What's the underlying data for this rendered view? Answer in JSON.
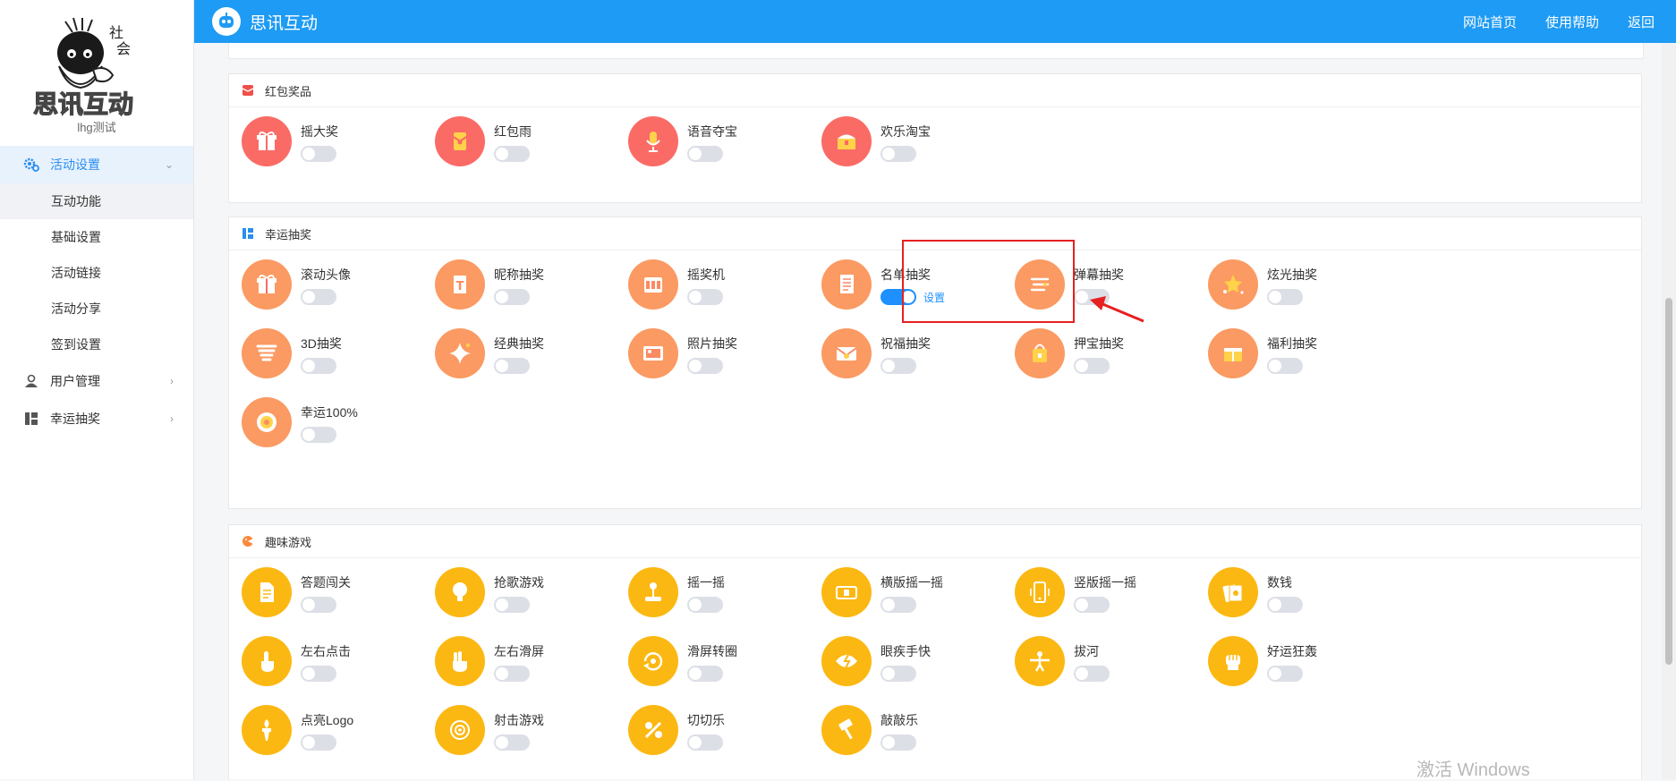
{
  "app": {
    "logo_text": "思讯互动",
    "account_name": "lhg测试",
    "header_title": "思讯互动",
    "nav": [
      "网站首页",
      "使用帮助",
      "返回"
    ]
  },
  "sidebar": {
    "groups": [
      {
        "label": "活动设置",
        "icon": "gear-icon",
        "expanded": true,
        "subitems": [
          "互动功能",
          "基础设置",
          "活动链接",
          "活动分享",
          "签到设置"
        ]
      },
      {
        "label": "用户管理",
        "icon": "user-icon",
        "expanded": false
      },
      {
        "label": "幸运抽奖",
        "icon": "grid-icon",
        "expanded": false
      }
    ]
  },
  "sections": [
    {
      "title": "红包奖品",
      "icon": "red-packet-icon",
      "items": [
        {
          "label": "摇大奖",
          "on": false,
          "color": "red",
          "icon": "gift-box-icon"
        },
        {
          "label": "红包雨",
          "on": false,
          "color": "red",
          "icon": "red-envelope-icon"
        },
        {
          "label": "语音夺宝",
          "on": false,
          "color": "red",
          "icon": "microphone-icon"
        },
        {
          "label": "欢乐淘宝",
          "on": false,
          "color": "red",
          "icon": "treasure-chest-icon"
        }
      ]
    },
    {
      "title": "幸运抽奖",
      "icon": "lottery-icon",
      "items": [
        {
          "label": "滚动头像",
          "on": false,
          "color": "orange",
          "icon": "gift-box-icon"
        },
        {
          "label": "昵称抽奖",
          "on": false,
          "color": "orange",
          "icon": "letter-card-icon"
        },
        {
          "label": "摇奖机",
          "on": false,
          "color": "orange",
          "icon": "slot-machine-icon"
        },
        {
          "label": "名单抽奖",
          "on": true,
          "color": "orange",
          "icon": "list-icon",
          "link": "设置"
        },
        {
          "label": "弹幕抽奖",
          "on": false,
          "color": "orange",
          "icon": "danmaku-icon"
        },
        {
          "label": "炫光抽奖",
          "on": false,
          "color": "orange",
          "icon": "stars-icon"
        },
        {
          "label": "3D抽奖",
          "on": false,
          "color": "orange",
          "icon": "tornado-icon"
        },
        {
          "label": "经典抽奖",
          "on": false,
          "color": "orange",
          "icon": "sparkle-icon"
        },
        {
          "label": "照片抽奖",
          "on": false,
          "color": "orange",
          "icon": "photo-icon"
        },
        {
          "label": "祝福抽奖",
          "on": false,
          "color": "orange",
          "icon": "envelope-icon"
        },
        {
          "label": "押宝抽奖",
          "on": false,
          "color": "orange",
          "icon": "bag-icon"
        },
        {
          "label": "福利抽奖",
          "on": false,
          "color": "orange",
          "icon": "gift-card-icon"
        },
        {
          "label": "幸运100%",
          "on": false,
          "color": "orange",
          "icon": "target-icon"
        }
      ]
    },
    {
      "title": "趣味游戏",
      "icon": "game-icon",
      "items": [
        {
          "label": "答题闯关",
          "on": false,
          "color": "yellow",
          "icon": "document-icon"
        },
        {
          "label": "抢歌游戏",
          "on": false,
          "color": "yellow",
          "icon": "bulb-icon"
        },
        {
          "label": "摇一摇",
          "on": false,
          "color": "yellow",
          "icon": "joystick-icon"
        },
        {
          "label": "横版摇一摇",
          "on": false,
          "color": "yellow",
          "icon": "phone-landscape-icon"
        },
        {
          "label": "竖版摇一摇",
          "on": false,
          "color": "yellow",
          "icon": "phone-portrait-icon"
        },
        {
          "label": "数钱",
          "on": false,
          "color": "yellow",
          "icon": "money-icon"
        },
        {
          "label": "左右点击",
          "on": false,
          "color": "yellow",
          "icon": "tap-hand-icon"
        },
        {
          "label": "左右滑屏",
          "on": false,
          "color": "yellow",
          "icon": "swipe-hand-icon"
        },
        {
          "label": "滑屏转圈",
          "on": false,
          "color": "yellow",
          "icon": "rotate-icon"
        },
        {
          "label": "眼疾手快",
          "on": false,
          "color": "yellow",
          "icon": "eye-icon"
        },
        {
          "label": "拔河",
          "on": false,
          "color": "yellow",
          "icon": "tug-of-war-icon"
        },
        {
          "label": "好运狂轰",
          "on": false,
          "color": "yellow",
          "icon": "fist-icon"
        },
        {
          "label": "点亮Logo",
          "on": false,
          "color": "yellow",
          "icon": "torch-icon"
        },
        {
          "label": "射击游戏",
          "on": false,
          "color": "yellow",
          "icon": "crosshair-icon"
        },
        {
          "label": "切切乐",
          "on": false,
          "color": "yellow",
          "icon": "slice-icon"
        },
        {
          "label": "敲敲乐",
          "on": false,
          "color": "yellow",
          "icon": "hammer-icon"
        }
      ]
    }
  ],
  "watermark": "激活 Windows",
  "colors": {
    "header": "#1e9bf4",
    "red": "#fb6b66",
    "orange": "#fb9a62",
    "yellow": "#fcb812",
    "accent": "#1e90ff",
    "highlight_box": "#e72020"
  }
}
